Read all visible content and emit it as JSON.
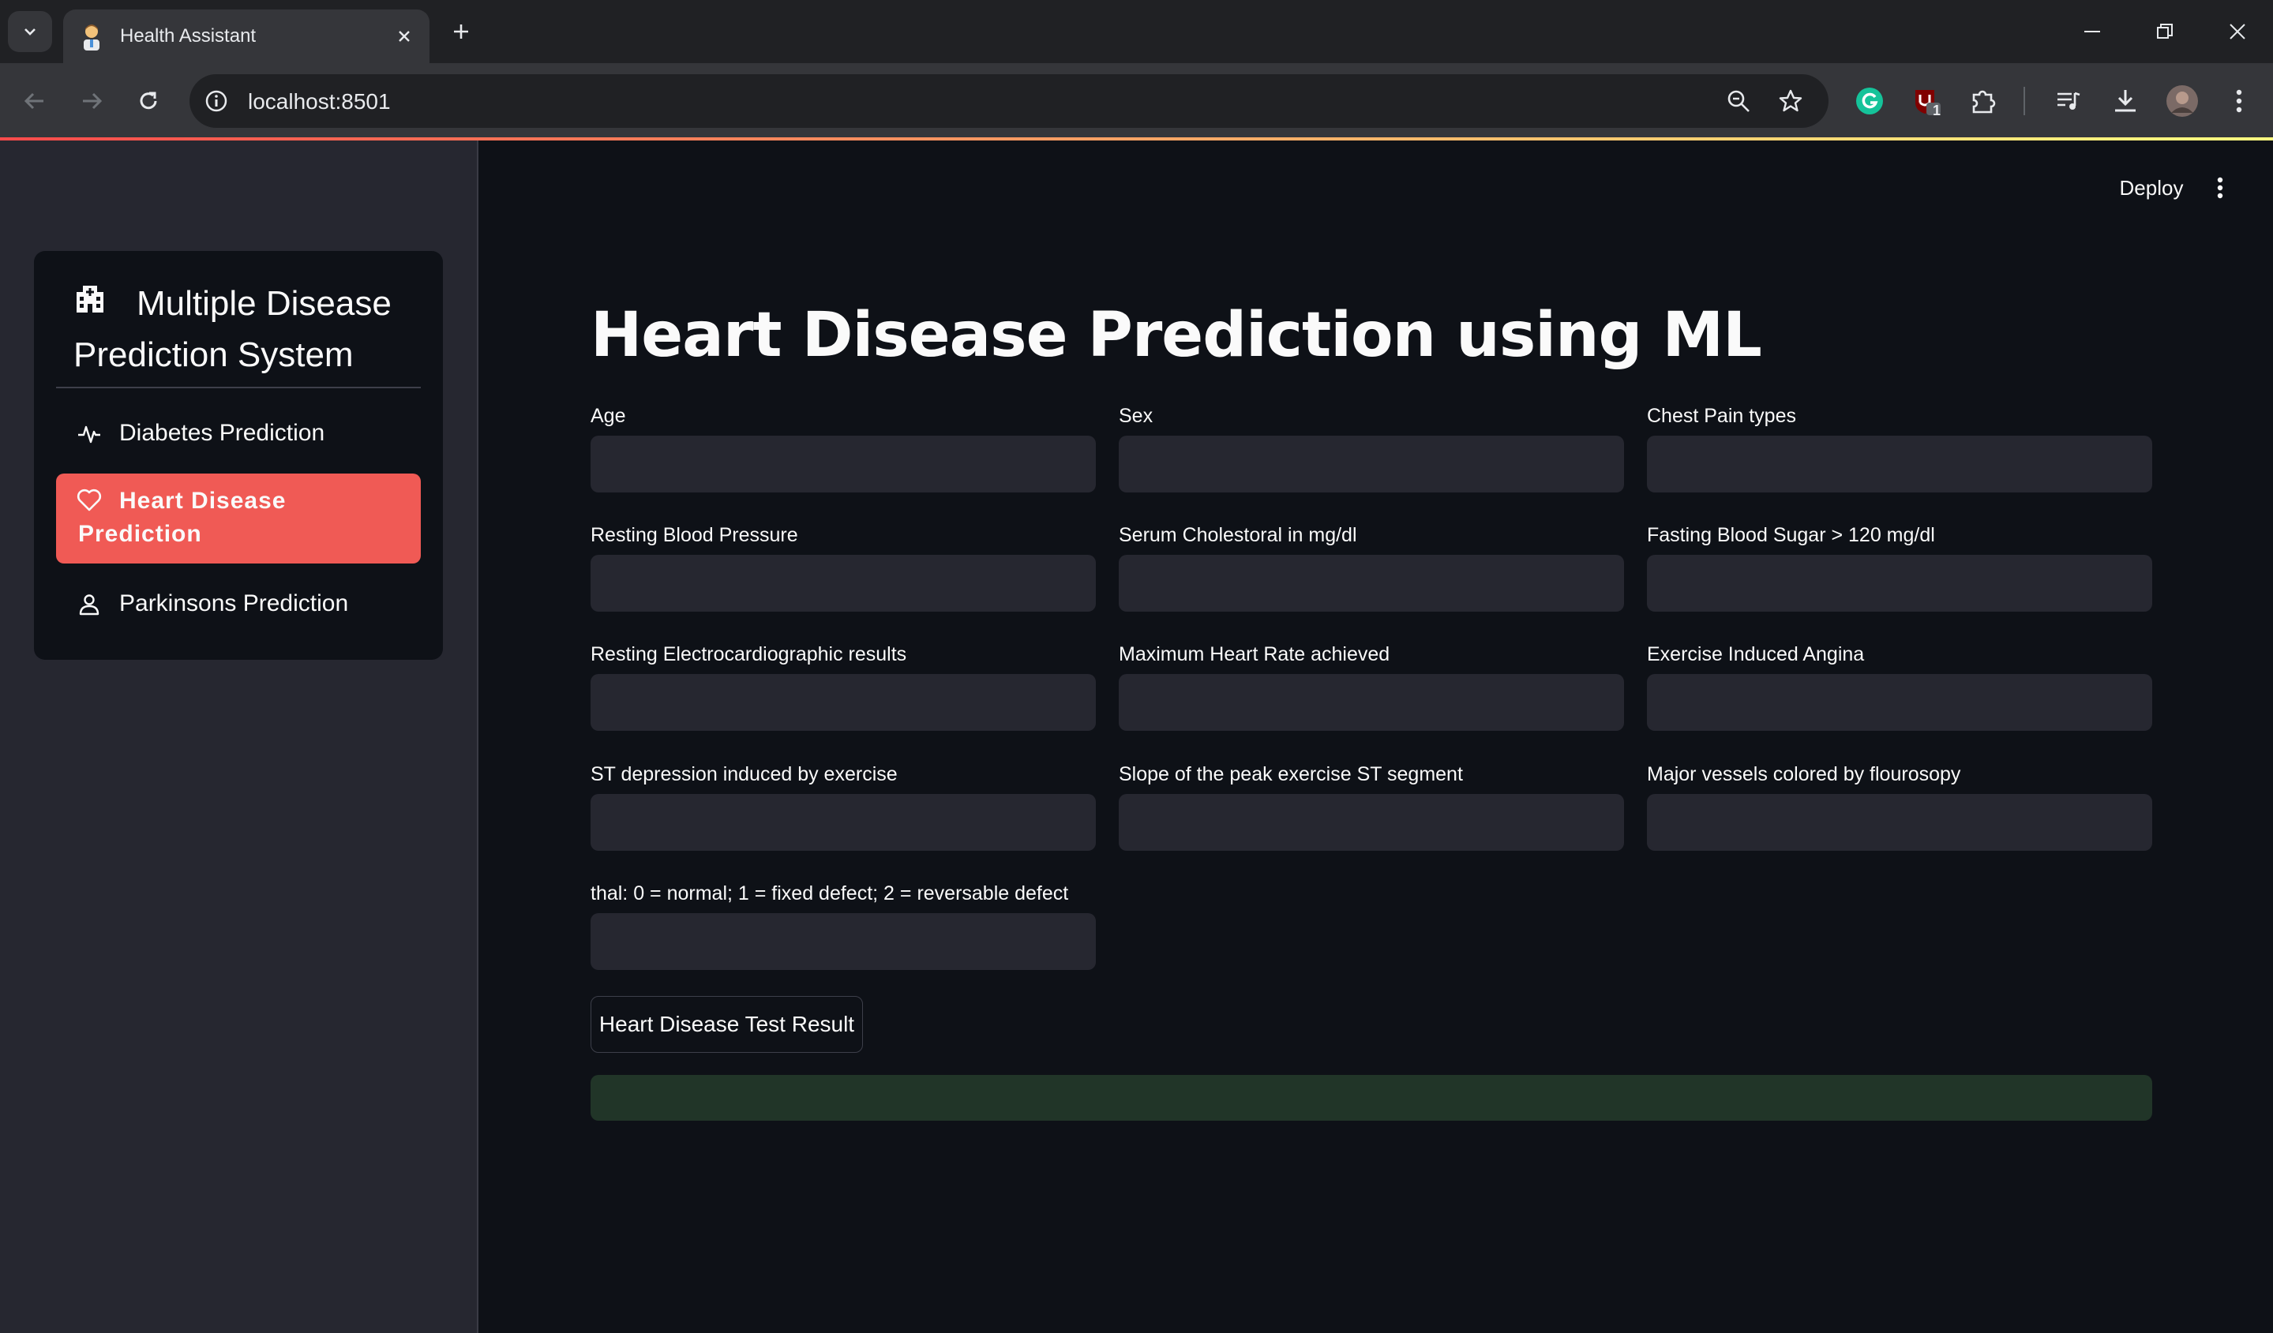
{
  "browser": {
    "tab_title": "Health Assistant",
    "url": "localhost:8501",
    "extension_badge": "1"
  },
  "app": {
    "deploy_label": "Deploy"
  },
  "sidebar": {
    "title": "Multiple Disease Prediction System",
    "items": [
      {
        "label": "Diabetes Prediction",
        "icon": "activity-icon"
      },
      {
        "label": "Heart Disease Prediction",
        "icon": "heart-icon",
        "active": true
      },
      {
        "label": "Parkinsons Prediction",
        "icon": "person-icon"
      }
    ]
  },
  "main": {
    "title": "Heart Disease Prediction using ML",
    "fields": [
      {
        "label": "Age",
        "value": ""
      },
      {
        "label": "Sex",
        "value": ""
      },
      {
        "label": "Chest Pain types",
        "value": ""
      },
      {
        "label": "Resting Blood Pressure",
        "value": ""
      },
      {
        "label": "Serum Cholestoral in mg/dl",
        "value": ""
      },
      {
        "label": "Fasting Blood Sugar > 120 mg/dl",
        "value": ""
      },
      {
        "label": "Resting Electrocardiographic results",
        "value": ""
      },
      {
        "label": "Maximum Heart Rate achieved",
        "value": ""
      },
      {
        "label": "Exercise Induced Angina",
        "value": ""
      },
      {
        "label": "ST depression induced by exercise",
        "value": ""
      },
      {
        "label": "Slope of the peak exercise ST segment",
        "value": ""
      },
      {
        "label": "Major vessels colored by flourosopy",
        "value": ""
      },
      {
        "label": "thal: 0 = normal; 1 = fixed defect; 2 = reversable defect",
        "value": ""
      }
    ],
    "button_label": "Heart Disease Test Result",
    "result_text": ""
  },
  "colors": {
    "accent": "#f05a55",
    "background": "#0e1117",
    "sidebar": "#262730",
    "input": "#262730",
    "success_box": "#213528"
  }
}
